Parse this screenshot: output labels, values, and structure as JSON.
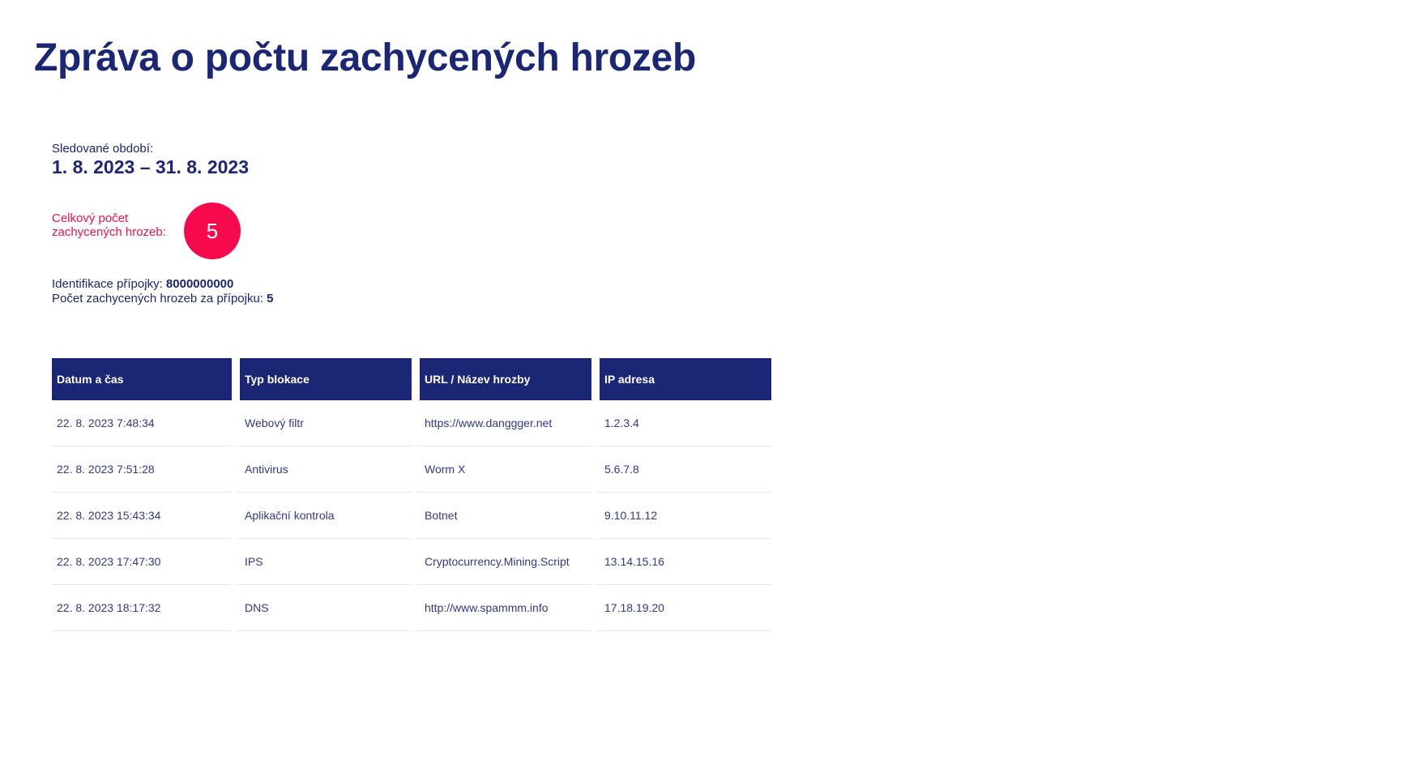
{
  "report": {
    "title": "Zpráva o počtu zachycených hrozeb",
    "period_label": "Sledované období:",
    "period_value": "1. 8. 2023 – 31. 8. 2023",
    "total_label": "Celkový počet zachycených hrozeb:",
    "total_value": "5",
    "connection_id_label": "Identifikace přípojky:",
    "connection_id_value": "8000000000",
    "connection_count_label": "Počet zachycených hrozeb za přípojku:",
    "connection_count_value": "5"
  },
  "table": {
    "headers": [
      "Datum a čas",
      "Typ blokace",
      "URL / Název hrozby",
      "IP adresa"
    ],
    "rows": [
      [
        "22. 8. 2023 7:48:34",
        "Webový filtr",
        "https://www.danggger.net",
        "1.2.3.4"
      ],
      [
        "22. 8. 2023 7:51:28",
        "Antivirus",
        "Worm X",
        "5.6.7.8"
      ],
      [
        "22. 8. 2023 15:43:34",
        "Aplikační kontrola",
        "Botnet",
        "9.10.11.12"
      ],
      [
        "22. 8. 2023 17:47:30",
        "IPS",
        "Cryptocurrency.Mining.Script",
        "13.14.15.16"
      ],
      [
        "22. 8. 2023 18:17:32",
        "DNS",
        "http://www.spammm.info",
        "17.18.19.20"
      ]
    ]
  },
  "colors": {
    "primary": "#1b2675",
    "accent": "#f70a4d"
  }
}
